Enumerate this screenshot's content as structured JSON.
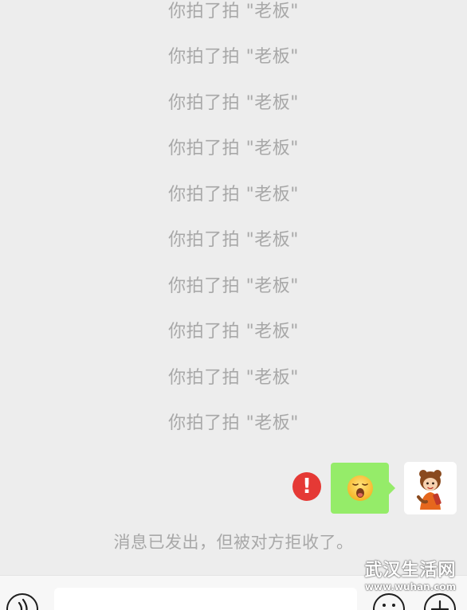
{
  "chat": {
    "pat_messages": [
      {
        "text": "你拍了拍 \"老板\""
      },
      {
        "text": "你拍了拍 \"老板\""
      },
      {
        "text": "你拍了拍 \"老板\""
      },
      {
        "text": "你拍了拍 \"老板\""
      },
      {
        "text": "你拍了拍 \"老板\""
      },
      {
        "text": "你拍了拍 \"老板\""
      },
      {
        "text": "你拍了拍 \"老板\""
      },
      {
        "text": "你拍了拍 \"老板\""
      },
      {
        "text": "你拍了拍 \"老板\""
      },
      {
        "text": "你拍了拍 \"老板\""
      }
    ],
    "sent_message": {
      "emoji": "yawning-face-emoji",
      "status_icon": "exclamation-icon",
      "status_color": "#e53935",
      "bubble_color": "#95ec69"
    },
    "system_notice": "消息已发出，但被对方拒收了。"
  },
  "input_bar": {
    "voice_icon": "voice-icon",
    "emoji_icon": "smiley-icon",
    "more_icon": "plus-icon"
  },
  "watermark": {
    "title": "武汉生活网",
    "url": "www.wuhan.com"
  }
}
